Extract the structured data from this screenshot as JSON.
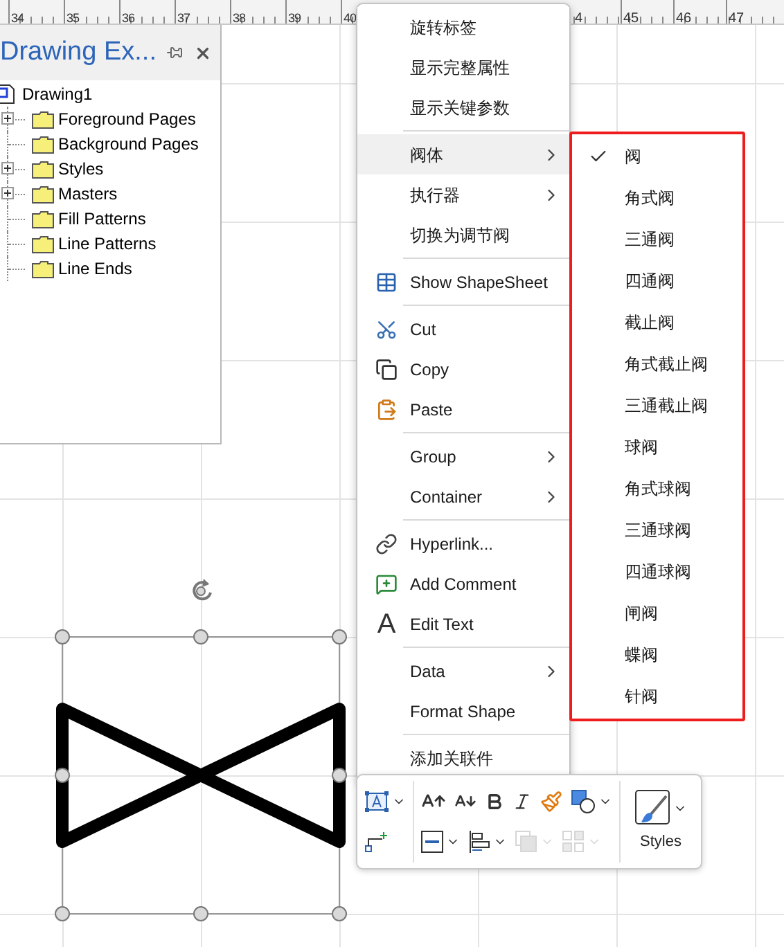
{
  "ruler": {
    "left_labels": [
      "34",
      "35",
      "36",
      "37",
      "38",
      "39",
      "40"
    ],
    "right_labels": [
      "4",
      "45",
      "46",
      "47"
    ]
  },
  "shapes_panel": {
    "title": "Drawing Ex...",
    "tree": [
      {
        "label": "Drawing1",
        "expandable": false,
        "children": [
          {
            "label": "Foreground Pages",
            "expandable": true
          },
          {
            "label": "Background Pages",
            "expandable": false
          },
          {
            "label": "Styles",
            "expandable": true
          },
          {
            "label": "Masters",
            "expandable": true
          },
          {
            "label": "Fill Patterns",
            "expandable": false
          },
          {
            "label": "Line Patterns",
            "expandable": false
          },
          {
            "label": "Line Ends",
            "expandable": false
          }
        ]
      }
    ]
  },
  "context_menu": {
    "groups": [
      [
        {
          "label": "旋转标签",
          "kind": "plain",
          "submenu": false,
          "selected": false
        },
        {
          "label": "显示完整属性",
          "kind": "plain",
          "submenu": false,
          "selected": false
        },
        {
          "label": "显示关键参数",
          "kind": "plain",
          "submenu": false,
          "selected": false
        }
      ],
      [
        {
          "label": "阀体",
          "kind": "plain",
          "submenu": true,
          "selected": true
        },
        {
          "label": "执行器",
          "kind": "plain",
          "submenu": true,
          "selected": false
        },
        {
          "label": "切换为调节阀",
          "kind": "plain",
          "submenu": false,
          "selected": false
        }
      ],
      [
        {
          "label": "Show ShapeSheet",
          "kind": "table",
          "submenu": false,
          "selected": false
        }
      ],
      [
        {
          "label": "Cut",
          "kind": "scissors",
          "submenu": false,
          "selected": false
        },
        {
          "label": "Copy",
          "kind": "copy",
          "submenu": false,
          "selected": false
        },
        {
          "label": "Paste",
          "kind": "paste",
          "submenu": false,
          "selected": false
        }
      ],
      [
        {
          "label": "Group",
          "kind": "plain",
          "submenu": true,
          "selected": false
        },
        {
          "label": "Container",
          "kind": "plain",
          "submenu": true,
          "selected": false
        }
      ],
      [
        {
          "label": "Hyperlink...",
          "kind": "link",
          "submenu": false,
          "selected": false
        },
        {
          "label": "Add Comment",
          "kind": "comment",
          "submenu": false,
          "selected": false
        },
        {
          "label": "Edit Text",
          "kind": "glyph",
          "glyph": "A",
          "submenu": false,
          "selected": false
        }
      ],
      [
        {
          "label": "Data",
          "kind": "plain",
          "submenu": true,
          "selected": false
        },
        {
          "label": "Format Shape",
          "kind": "plain",
          "submenu": false,
          "selected": false
        }
      ],
      [
        {
          "label": "添加关联件",
          "kind": "plain",
          "submenu": false,
          "selected": false
        }
      ]
    ]
  },
  "submenu": {
    "items": [
      {
        "label": "阀",
        "checked": true
      },
      {
        "label": "角式阀",
        "checked": false
      },
      {
        "label": "三通阀",
        "checked": false
      },
      {
        "label": "四通阀",
        "checked": false
      },
      {
        "label": "截止阀",
        "checked": false
      },
      {
        "label": "角式截止阀",
        "checked": false
      },
      {
        "label": "三通截止阀",
        "checked": false
      },
      {
        "label": "球阀",
        "checked": false
      },
      {
        "label": "角式球阀",
        "checked": false
      },
      {
        "label": "三通球阀",
        "checked": false
      },
      {
        "label": "四通球阀",
        "checked": false
      },
      {
        "label": "闸阀",
        "checked": false
      },
      {
        "label": "蝶阀",
        "checked": false
      },
      {
        "label": "针阀",
        "checked": false
      }
    ]
  },
  "mini_toolbar": {
    "left": [
      {
        "kind": "text-box",
        "dropdown": true,
        "disabled": false
      },
      {
        "kind": "connector",
        "dropdown": false,
        "disabled": false
      }
    ],
    "middle_rows": [
      [
        {
          "kind": "font-grow",
          "dropdown": false,
          "disabled": false
        },
        {
          "kind": "font-shrink",
          "dropdown": false,
          "disabled": false
        },
        {
          "kind": "bold",
          "dropdown": false,
          "disabled": false
        },
        {
          "kind": "italic",
          "dropdown": false,
          "disabled": false
        },
        {
          "kind": "format-painter",
          "dropdown": false,
          "disabled": false
        },
        {
          "kind": "fill",
          "dropdown": true,
          "disabled": false
        }
      ],
      [
        {
          "kind": "line",
          "dropdown": true,
          "disabled": false
        },
        {
          "kind": "align",
          "dropdown": true,
          "disabled": false
        },
        {
          "kind": "bring-front",
          "dropdown": true,
          "disabled": true
        },
        {
          "kind": "group",
          "dropdown": true,
          "disabled": true
        }
      ]
    ],
    "styles_label": "Styles"
  }
}
